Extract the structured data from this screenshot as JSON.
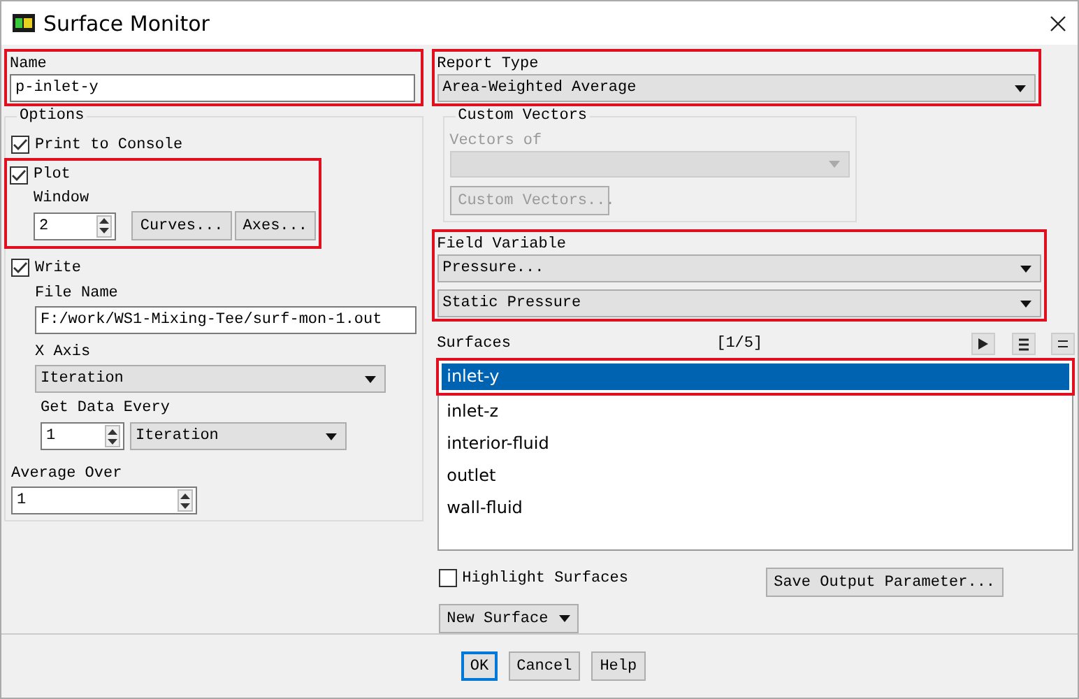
{
  "window": {
    "title": "Surface Monitor"
  },
  "name": {
    "label": "Name",
    "value": "p-inlet-y",
    "highlighted": true
  },
  "options": {
    "title": "Options",
    "print_to_console": {
      "label": "Print to Console",
      "checked": true
    },
    "plot": {
      "label": "Plot",
      "checked": true,
      "highlighted": true,
      "window_label": "Window",
      "window_value": "2",
      "buttons": [
        "Curves...",
        "Axes..."
      ]
    },
    "write": {
      "label": "Write",
      "checked": true
    },
    "file_name": {
      "label": "File Name",
      "value": "F:/work/WS1-Mixing-Tee/surf-mon-1.out"
    },
    "x_axis": {
      "label": "X Axis",
      "value": "Iteration"
    },
    "get_data_every": {
      "label": "Get Data Every",
      "value": "1",
      "unit": "Iteration"
    },
    "average_over": {
      "label": "Average Over",
      "value": "1"
    }
  },
  "report_type": {
    "label": "Report Type",
    "value": "Area-Weighted Average",
    "highlighted": true
  },
  "custom_vectors": {
    "title": "Custom Vectors",
    "vectors_of_label": "Vectors of",
    "button": "Custom Vectors...",
    "disabled": true
  },
  "field_variable": {
    "label": "Field Variable",
    "values": [
      "Pressure...",
      "Static Pressure"
    ],
    "highlighted": true
  },
  "surfaces": {
    "label": "Surfaces",
    "count": "[1/5]",
    "items": [
      {
        "label": "inlet-y",
        "selected": true,
        "highlighted": true
      },
      {
        "label": "inlet-z",
        "selected": false,
        "highlighted": false
      },
      {
        "label": "interior-fluid",
        "selected": false,
        "highlighted": false
      },
      {
        "label": "outlet",
        "selected": false,
        "highlighted": false
      },
      {
        "label": "wall-fluid",
        "selected": false,
        "highlighted": false
      }
    ]
  },
  "highlight_surfaces": {
    "label": "Highlight Surfaces",
    "checked": false
  },
  "save_output_parameter": "Save Output Parameter...",
  "new_surface": "New Surface",
  "footer_buttons": [
    {
      "label": "OK",
      "focused": true
    },
    {
      "label": "Cancel",
      "focused": false
    },
    {
      "label": "Help",
      "focused": false
    }
  ]
}
